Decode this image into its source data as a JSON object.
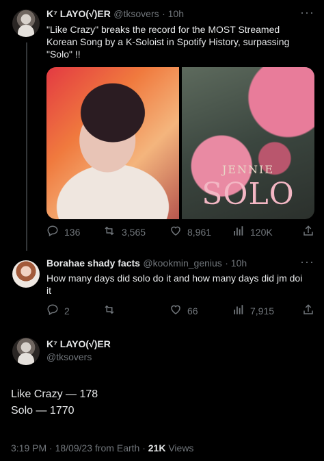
{
  "tweet1": {
    "name": "K⁷ LAYO(√)ER",
    "handle": "@tksovers",
    "time": "· 10h",
    "text": "\"Like Crazy\" breaks the record for the MOST Streamed Korean Song by a K-Soloist in Spotify History, surpassing \"Solo\" !!",
    "media_right": {
      "artist": "JENNIE",
      "title": "SOLO"
    },
    "actions": {
      "replies": "136",
      "retweets": "3,565",
      "likes": "8,961",
      "views": "120K"
    }
  },
  "tweet2": {
    "name": "Borahae shady facts",
    "handle": "@kookmin_genius",
    "time": "· 10h",
    "text": "How many days did solo do it and how many days did jm doi it",
    "actions": {
      "replies": "2",
      "likes": "66",
      "views": "7,915"
    }
  },
  "main": {
    "name": "K⁷ LAYO(√)ER",
    "handle": "@tksovers",
    "lines": [
      "Like Crazy — 178",
      "Solo — 1770"
    ],
    "footer_time": "3:19 PM · 18/09/23 from Earth · ",
    "footer_views": "21K",
    "footer_views_label": " Views"
  },
  "icons": [
    "reply-icon",
    "retweet-icon",
    "like-icon",
    "views-icon",
    "share-icon",
    "more-icon"
  ]
}
